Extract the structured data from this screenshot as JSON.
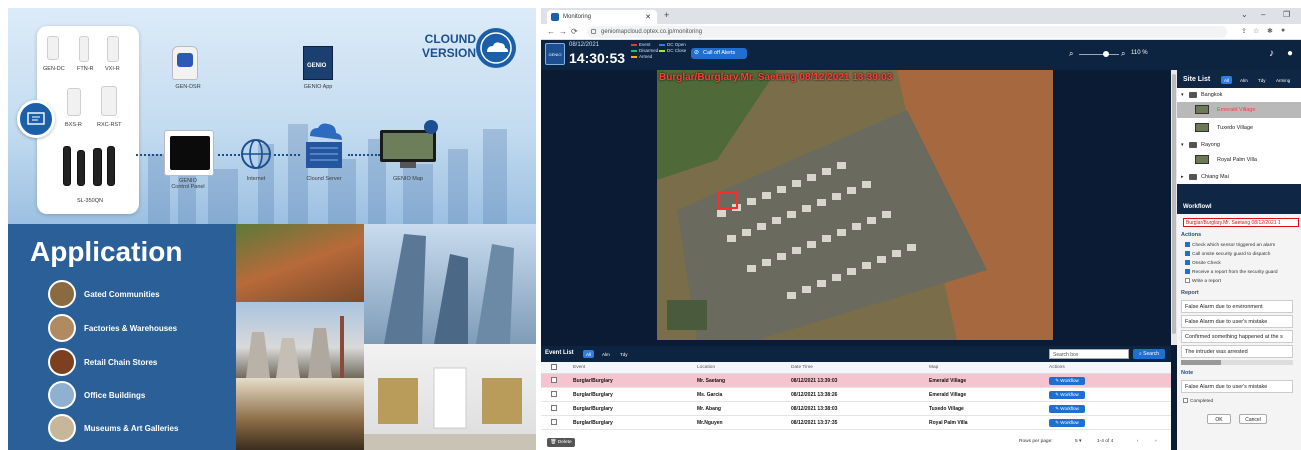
{
  "promo": {
    "cloud_version": "CLOUND\nVERSION",
    "devices": [
      "GEN-DC",
      "FTN-R",
      "VXI-R",
      "BXS-R",
      "RXC-RST",
      "SL-350QN"
    ],
    "nodes": {
      "siren": "GEN-DSR",
      "panel": "GENIO\nControl Panel",
      "internet": "Internet",
      "server": "Clound Server",
      "app": "GENIO App",
      "map": "GENIO Map"
    },
    "application_title": "Application",
    "applications": [
      "Gated Communities",
      "Factories & Warehouses",
      "Retail Chain Stores",
      "Office Buildings",
      "Museums & Art Galleries"
    ]
  },
  "browser": {
    "tab_title": "Monitoring",
    "url": "geniomapcloud.optex.co.jp/monitoring"
  },
  "header": {
    "date": "08/12/2021",
    "time": "14:30:53",
    "legend": [
      "Event",
      "Disarmed",
      "Armed",
      "DC Open",
      "DC Close"
    ],
    "legend_colors": [
      "#e53935",
      "#1fc06b",
      "#f0b400",
      "#2f7de1",
      "#a3e635"
    ],
    "call_off": "Call off Alerts",
    "zoom": "110 %"
  },
  "map": {
    "alarm_title": "Burglar/Burglary.Mr. Saetang 08/12/2021 13:39:03"
  },
  "site_list": {
    "title": "Site List",
    "filters": [
      "All",
      "Alm",
      "Tdy",
      "Arming"
    ],
    "tree": [
      {
        "label": "Bangkok",
        "type": "folder"
      },
      {
        "label": "Emerald Village",
        "type": "site",
        "selected": true
      },
      {
        "label": "Tuxedo Village",
        "type": "site"
      },
      {
        "label": "Rayong",
        "type": "folder"
      },
      {
        "label": "Royal Palm Villa",
        "type": "site"
      },
      {
        "label": "Chiang Mai",
        "type": "folder"
      }
    ]
  },
  "workflow": {
    "title": "Workflowl",
    "alarm": "Burglar/Burglary.Mr. Saetang 08/12/2021 1",
    "actions_label": "Actions",
    "actions": [
      {
        "label": "Check which sensor triggered an alarm",
        "checked": true
      },
      {
        "label": "Call onsite security guard to dispatch",
        "checked": true
      },
      {
        "label": "Onsite Check",
        "checked": true
      },
      {
        "label": "Receive a report from the security guard",
        "checked": true
      },
      {
        "label": "Write a report",
        "checked": false
      }
    ],
    "report_label": "Report",
    "reports": [
      "False Alarm due to environment",
      "False Alarm due to user's mistake",
      "Confirmed something happened at the s",
      "The intruder was arrested"
    ],
    "note_label": "Note",
    "note_value": "False Alarm due to user's mistake",
    "completed": "Completed",
    "ok": "OK",
    "cancel": "Cancel"
  },
  "event_list": {
    "title": "Event List",
    "filters": [
      "All",
      "Alm",
      "Tdy"
    ],
    "search_placeholder": "Search box",
    "search_button": "Search",
    "columns": [
      "Event",
      "Location",
      "Date Time",
      "Map",
      "Actions"
    ],
    "rows": [
      {
        "event": "Burglar/Burglary",
        "location": "Mr. Saetang",
        "datetime": "08/12/2021 13:39:03",
        "map": "Emerald Village",
        "action": "Workflow",
        "alarm": true
      },
      {
        "event": "Burglar/Burglary",
        "location": "Ms. Garcia",
        "datetime": "08/12/2021 13:38:26",
        "map": "Emerald Village",
        "action": "Workflow",
        "alarm": false
      },
      {
        "event": "Burglar/Burglary",
        "location": "Mr. Abang",
        "datetime": "08/12/2021 13:38:03",
        "map": "Tuxedo Village",
        "action": "Workflow",
        "alarm": false
      },
      {
        "event": "Burglar/Burglary",
        "location": "Mr.Nguyen",
        "datetime": "08/12/2021 13:37:35",
        "map": "Royal Palm Villa",
        "action": "Workflow",
        "alarm": false
      }
    ],
    "delete": "Delete",
    "rows_per_page_label": "Rows per page:",
    "rows_per_page": "5",
    "range": "1-4 of 4"
  }
}
